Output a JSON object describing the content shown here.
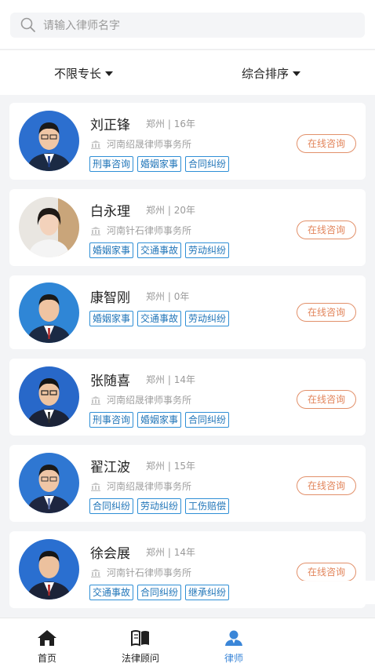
{
  "search": {
    "placeholder": "请输入律师名字"
  },
  "filters": {
    "specialty": "不限专长",
    "sort": "综合排序"
  },
  "lawyers": [
    {
      "name": "刘正锋",
      "city": "郑州",
      "years": "16年",
      "firm": "河南绍晟律师事务所",
      "tags": [
        "刑事咨询",
        "婚姻家事",
        "合同纠纷"
      ],
      "action": "在线咨询"
    },
    {
      "name": "白永理",
      "city": "郑州",
      "years": "20年",
      "firm": "河南针石律师事务所",
      "tags": [
        "婚姻家事",
        "交通事故",
        "劳动纠纷"
      ],
      "action": "在线咨询"
    },
    {
      "name": "康智刚",
      "city": "郑州",
      "years": "0年",
      "firm": "",
      "tags": [
        "婚姻家事",
        "交通事故",
        "劳动纠纷"
      ],
      "action": "在线咨询"
    },
    {
      "name": "张随喜",
      "city": "郑州",
      "years": "14年",
      "firm": "河南绍晟律师事务所",
      "tags": [
        "刑事咨询",
        "婚姻家事",
        "合同纠纷"
      ],
      "action": "在线咨询"
    },
    {
      "name": "翟江波",
      "city": "郑州",
      "years": "15年",
      "firm": "河南绍晟律师事务所",
      "tags": [
        "合同纠纷",
        "劳动纠纷",
        "工伤赔偿"
      ],
      "action": "在线咨询"
    },
    {
      "name": "徐会展",
      "city": "郑州",
      "years": "14年",
      "firm": "河南针石律师事务所",
      "tags": [
        "交通事故",
        "合同纠纷",
        "继承纠纷"
      ],
      "action": "在线咨询"
    }
  ],
  "tabbar": {
    "items": [
      {
        "label": "首页",
        "icon": "home-icon"
      },
      {
        "label": "法律顾问",
        "icon": "book-icon"
      },
      {
        "label": "律师",
        "icon": "lawyer-icon"
      }
    ]
  },
  "colors": {
    "accent": "#3a86d8",
    "tag_border": "#2f8fd6",
    "consult": "#e2845a"
  }
}
